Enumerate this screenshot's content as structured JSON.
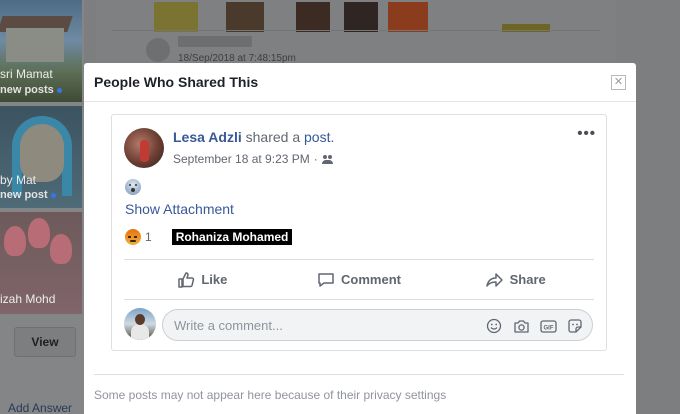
{
  "background": {
    "tiles": [
      {
        "name": "sri Mamat",
        "sub": "new posts"
      },
      {
        "name": "by Mat",
        "sub": "new post"
      },
      {
        "name": "izah Mohd"
      }
    ],
    "view_label": "View",
    "add_answer_label": "Add Answer",
    "card_date": "18/Sep/2018 at 7:48:15pm"
  },
  "modal": {
    "title": "People Who Shared This",
    "close_icon": "close-icon",
    "footer_note": "Some posts may not appear here because of their privacy settings"
  },
  "post": {
    "author": "Lesa Adzli",
    "shared_text": "shared a",
    "link_text": "post.",
    "timestamp": "September 18 at 9:23 PM",
    "separator": "·",
    "audience_icon": "friends-icon",
    "more_icon": "•••",
    "body_emoji": "fearful-face-emoji",
    "show_attachment": "Show Attachment",
    "reaction": {
      "icon": "angry-reaction-icon",
      "count": "1",
      "tooltip": "Rohaniza Mohamed"
    },
    "actions": {
      "like": "Like",
      "comment": "Comment",
      "share": "Share"
    },
    "comment_input": {
      "placeholder": "Write a comment...",
      "icons": [
        "emoji-icon",
        "camera-icon",
        "gif-icon",
        "sticker-icon"
      ]
    }
  },
  "colors": {
    "link_blue": "#385898",
    "secondary_text": "#616770",
    "overlay": "#7d7e80"
  }
}
